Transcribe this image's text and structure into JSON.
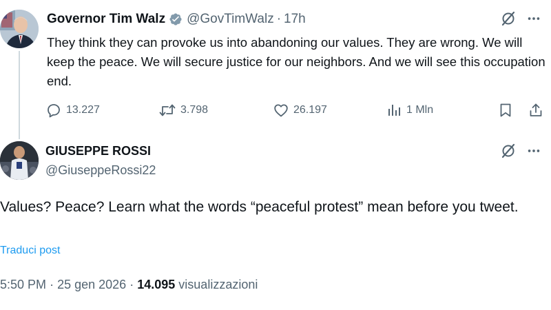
{
  "tweet1": {
    "name": "Governor Tim Walz",
    "handle": "@GovTimWalz",
    "separator": "·",
    "time": "17h",
    "text": "They think they can provoke us into abandoning our values. They are wrong. We will keep the peace. We will secure justice for our neighbors. And we will see this occupation end.",
    "replies": "13.227",
    "reposts": "3.798",
    "likes": "26.197",
    "views": "1 Mln"
  },
  "tweet2": {
    "name": "GIUSEPPE ROSSI",
    "handle": "@GiuseppeRossi22",
    "text": "Values? Peace? Learn what the words “peaceful protest” mean before you tweet.",
    "translate_label": "Traduci post",
    "time": "5:50 PM",
    "separator": "·",
    "date": "25 gen 2026",
    "separator2": "·",
    "views_count": "14.095",
    "views_label": "visualizzazioni"
  },
  "colors": {
    "accent": "#1d9bf0",
    "muted": "#536471",
    "text": "#0f1419",
    "verified": "#829aab"
  },
  "icons": [
    "verified-badge-icon",
    "grok-icon",
    "more-icon",
    "reply-icon",
    "repost-icon",
    "like-icon",
    "views-icon",
    "bookmark-icon",
    "share-icon"
  ]
}
